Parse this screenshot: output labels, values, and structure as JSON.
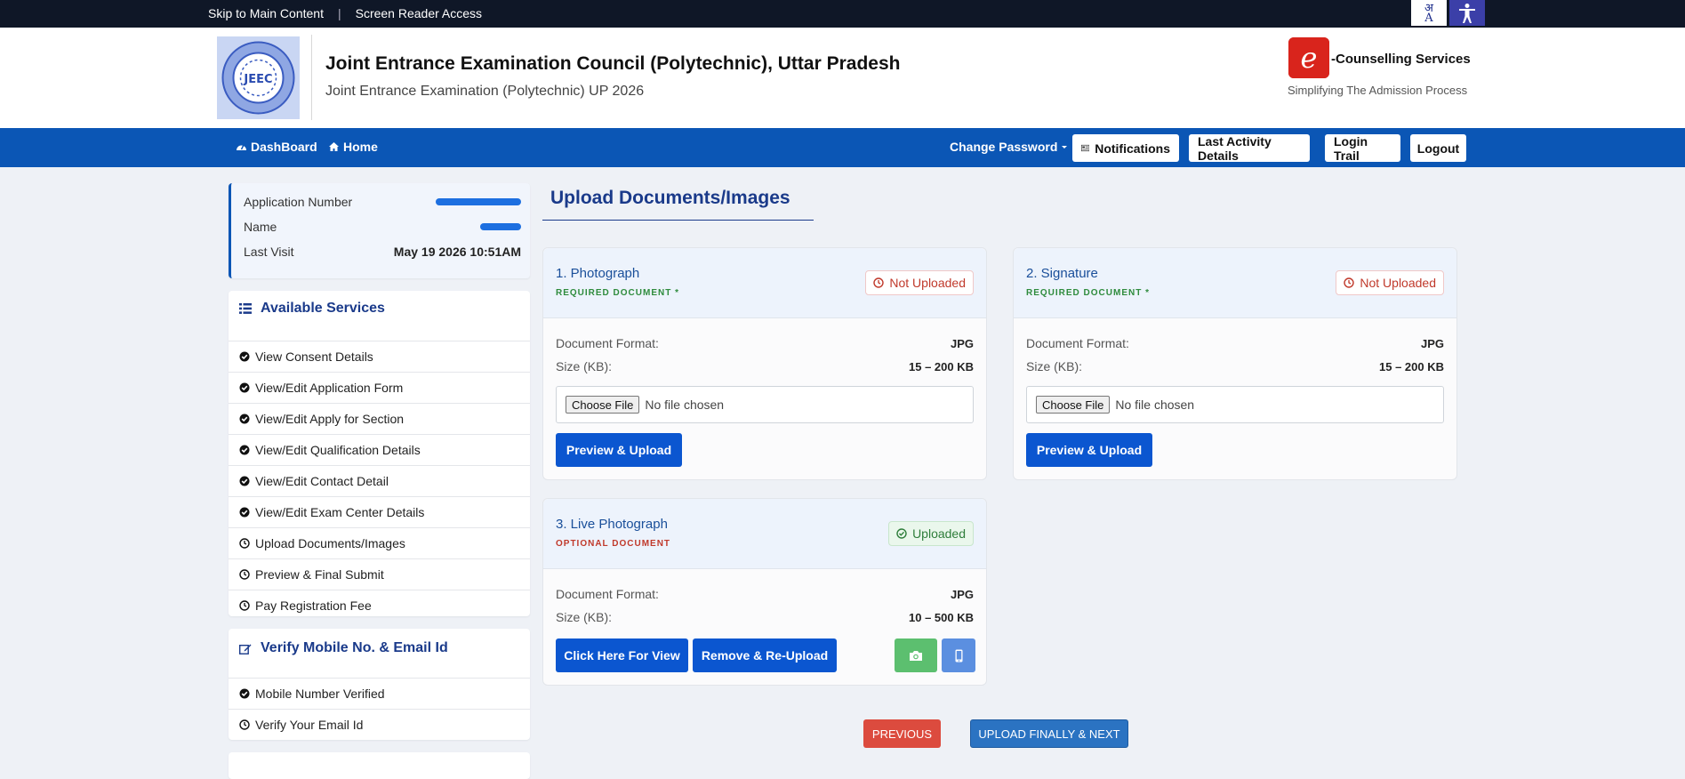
{
  "topbar": {
    "skip_link": "Skip to Main Content",
    "separator": "|",
    "screen_reader": "Screen Reader Access",
    "lang_glyph_top": "अ",
    "lang_glyph_bottom": "A"
  },
  "header": {
    "title": "Joint Entrance Examination Council (Polytechnic), Uttar Pradesh",
    "subtitle": "Joint Entrance Examination (Polytechnic) UP 2026",
    "logo_text": "JEEC",
    "ec_logo_letter": "e",
    "ec_title": "-Counselling Services",
    "ec_tagline": "Simplifying The Admission Process"
  },
  "nav": {
    "dashboard": "DashBoard",
    "home": "Home",
    "change_password": "Change Password",
    "notifications": "Notifications",
    "last_activity": "Last Activity Details",
    "login_trail": "Login Trail",
    "logout": "Logout"
  },
  "profile": {
    "app_number_label": "Application Number",
    "name_label": "Name",
    "last_visit_label": "Last Visit",
    "last_visit_value": "May 19 2026 10:51AM"
  },
  "services": {
    "title": "Available Services",
    "items": [
      {
        "label": "View Consent Details",
        "done": true
      },
      {
        "label": "View/Edit Application Form",
        "done": true
      },
      {
        "label": "View/Edit Apply for Section",
        "done": true
      },
      {
        "label": "View/Edit Qualification Details",
        "done": true
      },
      {
        "label": "View/Edit Contact Detail",
        "done": true
      },
      {
        "label": "View/Edit Exam Center Details",
        "done": true
      },
      {
        "label": "Upload Documents/Images",
        "done": false
      },
      {
        "label": "Preview & Final Submit",
        "done": false
      },
      {
        "label": "Pay Registration Fee",
        "done": false
      }
    ]
  },
  "verify": {
    "title": "Verify Mobile No. & Email Id",
    "items": [
      {
        "label": "Mobile Number Verified",
        "done": true
      },
      {
        "label": "Verify Your Email Id",
        "done": false
      }
    ]
  },
  "main": {
    "title": "Upload Documents/Images",
    "format_label": "Document Format:",
    "size_label": "Size (KB):",
    "choose_file": "Choose File",
    "no_file": "No file chosen",
    "docs": [
      {
        "name": "1. Photograph",
        "requirement": "REQUIRED DOCUMENT *",
        "status": "Not Uploaded",
        "format": "JPG",
        "size": "15 – 200 KB",
        "action": "Preview & Upload"
      },
      {
        "name": "2. Signature",
        "requirement": "REQUIRED DOCUMENT *",
        "status": "Not Uploaded",
        "format": "JPG",
        "size": "15 – 200 KB",
        "action": "Preview & Upload"
      },
      {
        "name": "3. Live Photograph",
        "requirement": "OPTIONAL DOCUMENT",
        "status": "Uploaded",
        "format": "JPG",
        "size": "10 – 500 KB",
        "view_action": "Click Here For View",
        "reupload_action": "Remove & Re-Upload"
      }
    ],
    "previous": "PREVIOUS",
    "next": "UPLOAD FINALLY & NEXT"
  },
  "colors": {
    "primary": "#0b56b5",
    "topbar": "#0f1727",
    "danger": "#dc4b3e",
    "success": "#2e7d3a"
  }
}
